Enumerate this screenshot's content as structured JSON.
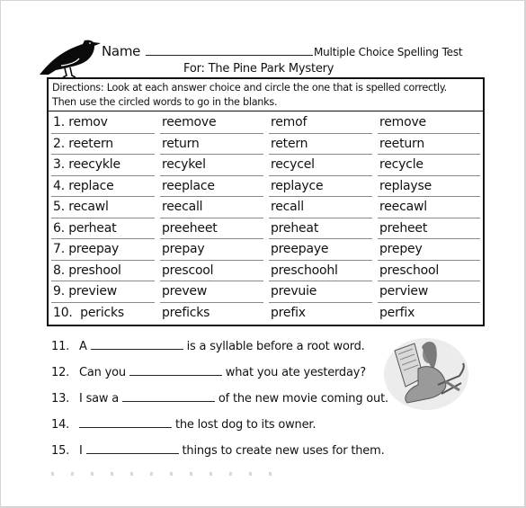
{
  "header": {
    "name_label": "Name",
    "test_title": "Multiple Choice Spelling Test",
    "subtitle": "For: The Pine Park Mystery",
    "bird_icon": "crow-icon"
  },
  "directions": {
    "line1": "Directions: Look at each answer choice and circle the one that is spelled correctly.",
    "line2": "Then use the circled words to go in the blanks."
  },
  "questions": [
    {
      "choices": [
        "1. remov",
        "reemove",
        "remof",
        "remove"
      ]
    },
    {
      "choices": [
        "2. reetern",
        "return",
        "retern",
        "reeturn"
      ]
    },
    {
      "choices": [
        "3. reecykle",
        "recykel",
        "recycel",
        "recycle"
      ]
    },
    {
      "choices": [
        "4. replace",
        "reeplace",
        "replayce",
        "replayse"
      ]
    },
    {
      "choices": [
        "5. recawl",
        "reecall",
        "recall",
        "reecawl"
      ]
    },
    {
      "choices": [
        "6. perheat",
        "preeheet",
        "preheat",
        "preheet"
      ]
    },
    {
      "choices": [
        "7. preepay",
        "prepay",
        "preepaye",
        "prepey"
      ]
    },
    {
      "choices": [
        "8. preshool",
        "prescool",
        "preschoohl",
        "preschool"
      ]
    },
    {
      "choices": [
        "9. preview",
        "prevew",
        "prevuie",
        "perview"
      ]
    },
    {
      "choices": [
        "10.  pericks",
        "preficks",
        "prefix",
        "perfix"
      ]
    }
  ],
  "fill_in": [
    {
      "number": "11.",
      "before": "A",
      "after": "is a syllable before a root word."
    },
    {
      "number": "12.",
      "before": "Can you",
      "after": "what you ate yesterday?"
    },
    {
      "number": "13.",
      "before": "I saw a",
      "after": "of the new movie coming out."
    },
    {
      "number": "14.",
      "before": "",
      "after": "the lost dog to its owner."
    },
    {
      "number": "15.",
      "before": "I",
      "after": "things to create new uses for them."
    }
  ],
  "illustration": "person-reading-newspaper-icon"
}
